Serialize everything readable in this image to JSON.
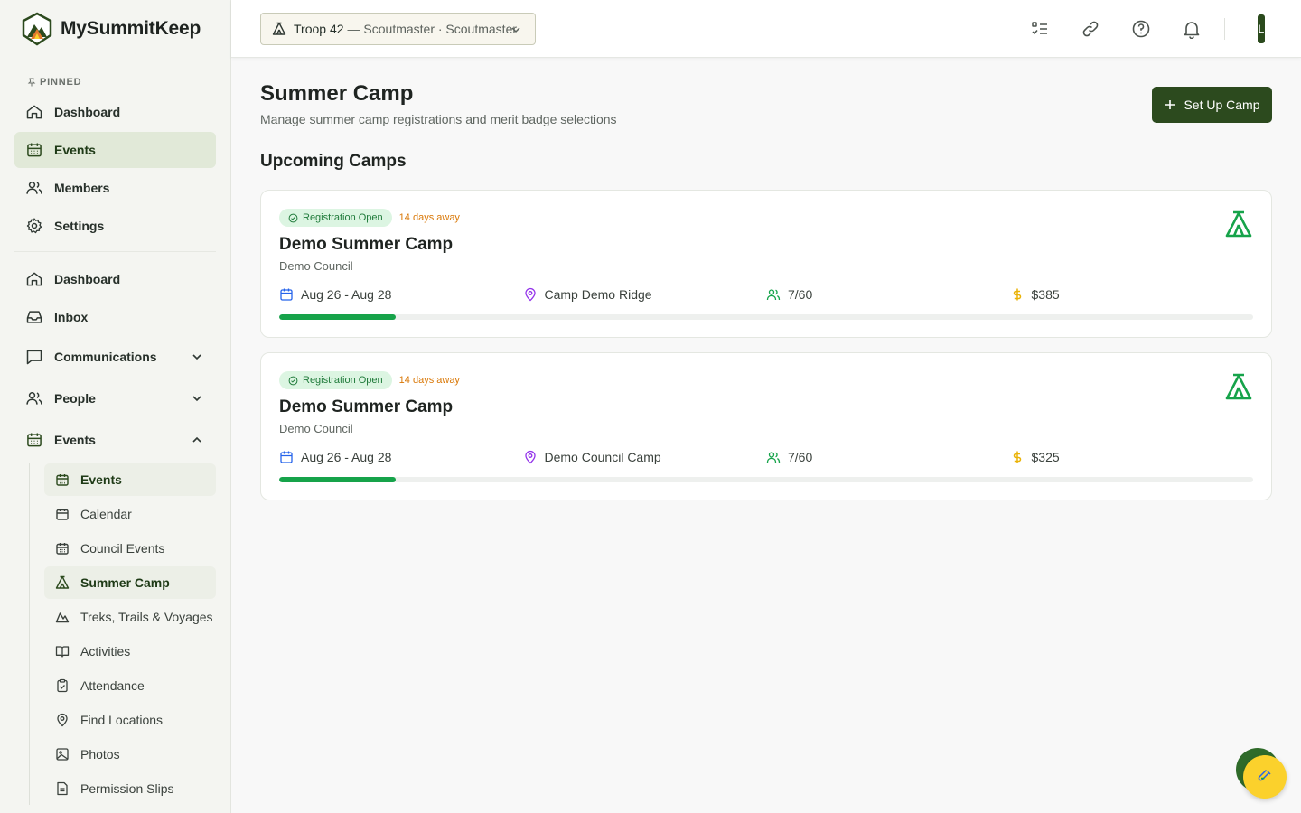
{
  "app": {
    "name": "MySummitKeep"
  },
  "sidebar": {
    "pinned_label": "PINNED",
    "pinned": [
      {
        "label": "Dashboard",
        "icon": "home-icon"
      },
      {
        "label": "Events",
        "icon": "calendar-icon"
      },
      {
        "label": "Members",
        "icon": "users-icon"
      },
      {
        "label": "Settings",
        "icon": "gear-icon"
      }
    ],
    "main": [
      {
        "label": "Dashboard",
        "icon": "home-icon"
      },
      {
        "label": "Inbox",
        "icon": "inbox-icon"
      },
      {
        "label": "Communications",
        "icon": "message-icon"
      },
      {
        "label": "People",
        "icon": "users-icon"
      },
      {
        "label": "Events",
        "icon": "calendar-icon"
      }
    ],
    "events_sub": [
      {
        "label": "Events",
        "icon": "calendar-icon"
      },
      {
        "label": "Calendar",
        "icon": "calendar-icon"
      },
      {
        "label": "Council Events",
        "icon": "calendar-icon"
      },
      {
        "label": "Summer Camp",
        "icon": "tent-icon"
      },
      {
        "label": "Treks, Trails & Voyages",
        "icon": "mountain-icon"
      },
      {
        "label": "Activities",
        "icon": "book-icon"
      },
      {
        "label": "Attendance",
        "icon": "clipboard-icon"
      },
      {
        "label": "Find Locations",
        "icon": "map-pin-icon"
      },
      {
        "label": "Photos",
        "icon": "image-icon"
      },
      {
        "label": "Permission Slips",
        "icon": "file-icon"
      }
    ]
  },
  "header": {
    "troop": "Troop 42",
    "troop_role": "— Scoutmaster · Scoutmaster",
    "avatar_initial": "L"
  },
  "page": {
    "title": "Summer Camp",
    "subtitle": "Manage summer camp registrations and merit badge selections",
    "setup_button": "Set Up Camp",
    "section_title": "Upcoming Camps"
  },
  "camps": [
    {
      "status": "Registration Open",
      "days_away": "14 days away",
      "name": "Demo Summer Camp",
      "council": "Demo Council",
      "dates": "Aug 26 - Aug 28",
      "location": "Camp Demo Ridge",
      "capacity": "7/60",
      "price": "$385",
      "progress": 0.12
    },
    {
      "status": "Registration Open",
      "days_away": "14 days away",
      "name": "Demo Summer Camp",
      "council": "Demo Council",
      "dates": "Aug 26 - Aug 28",
      "location": "Demo Council Camp",
      "capacity": "7/60",
      "price": "$325",
      "progress": 0.12
    }
  ],
  "colors": {
    "brand_dark": "#2c4a1e",
    "accent_green": "#16a34a",
    "warning_orange": "#d97706",
    "fab_yellow": "#fbd12c"
  }
}
